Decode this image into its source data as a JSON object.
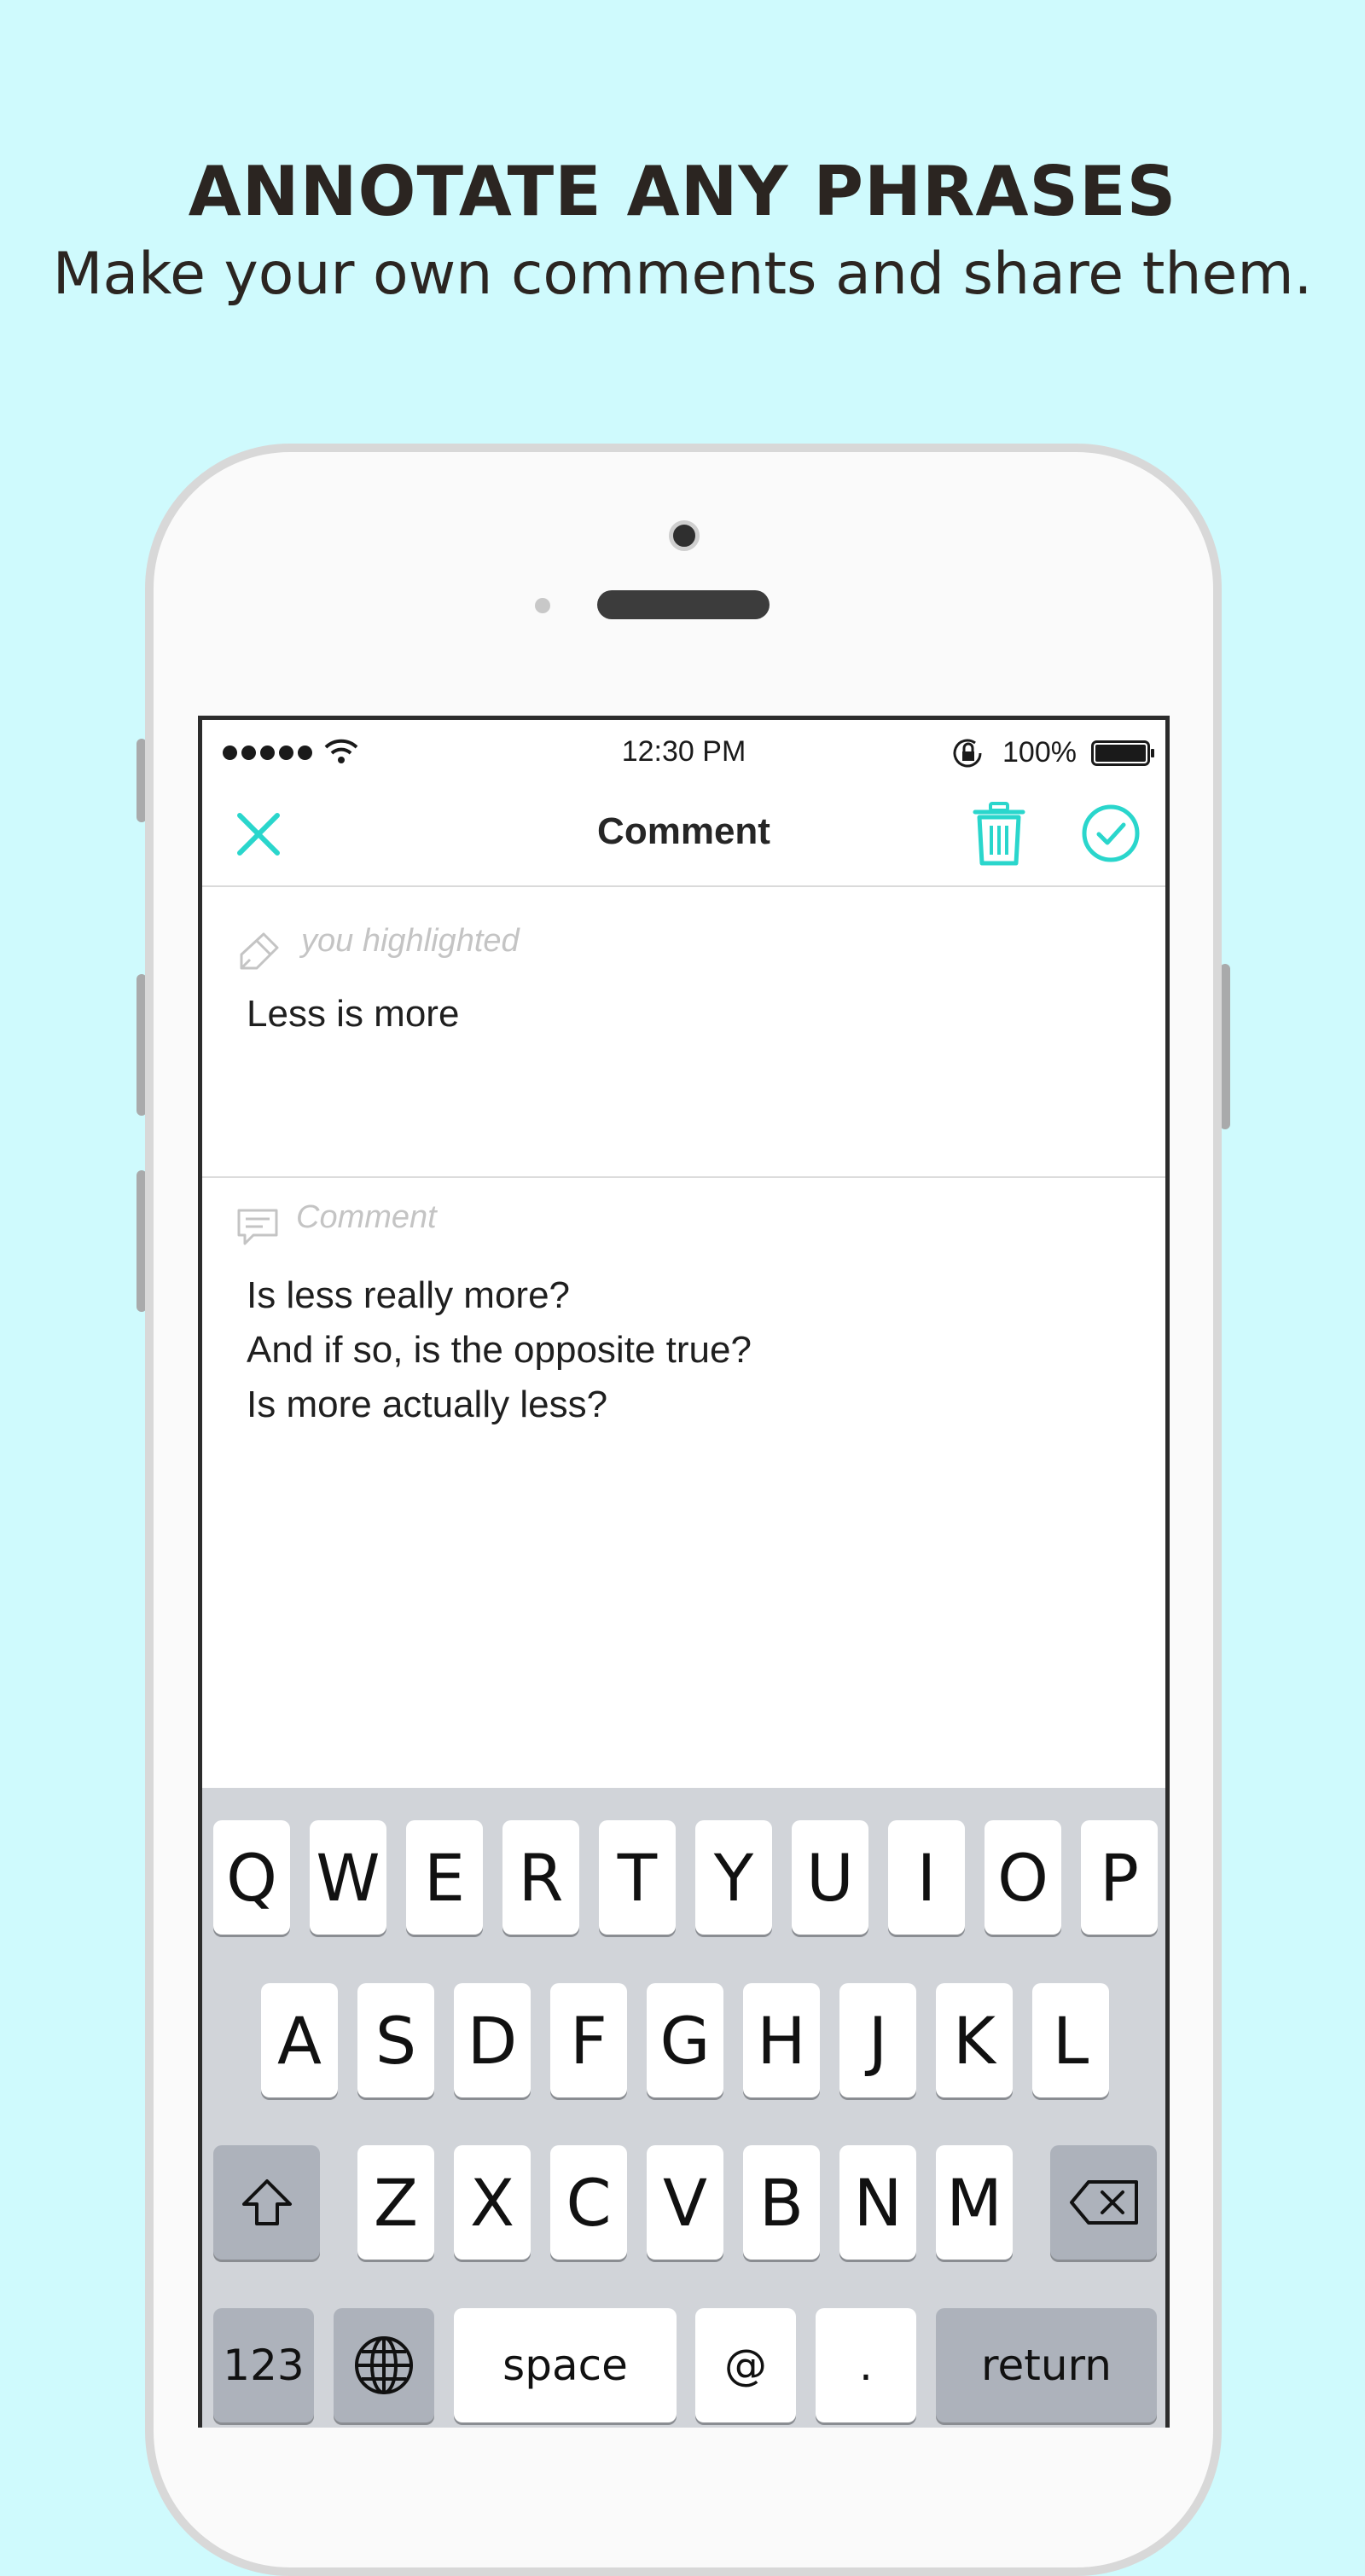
{
  "headline": "ANNOTATE ANY PHRASES",
  "subheadline": "Make your own comments and share them.",
  "status_bar": {
    "signal_icon": "signal-dots-icon",
    "wifi_icon": "wifi-icon",
    "time": "12:30 PM",
    "lock_icon": "orientation-lock-icon",
    "battery_percent": "100%",
    "battery_icon": "battery-icon"
  },
  "nav": {
    "title": "Comment",
    "close_icon": "close-icon",
    "delete_icon": "trash-icon",
    "confirm_icon": "check-circle-icon",
    "accent_color": "#2ad6cc"
  },
  "highlight": {
    "label": "you highlighted",
    "icon": "highlighter-pen-icon",
    "text": "Less is more"
  },
  "comment": {
    "label": "Comment",
    "icon": "comment-bubble-icon",
    "lines": [
      "Is less really more?",
      "And if so, is the opposite true?",
      "Is more actually less?"
    ]
  },
  "keyboard": {
    "row1": [
      "Q",
      "W",
      "E",
      "R",
      "T",
      "Y",
      "U",
      "I",
      "O",
      "P"
    ],
    "row2": [
      "A",
      "S",
      "D",
      "F",
      "G",
      "H",
      "J",
      "K",
      "L"
    ],
    "row3": [
      "Z",
      "X",
      "C",
      "V",
      "B",
      "N",
      "M"
    ],
    "shift_icon": "shift-arrow-icon",
    "delete_icon": "backspace-icon",
    "numbers_label": "123",
    "globe_icon": "globe-icon",
    "space_label": "space",
    "at_label": "@",
    "period_label": ".",
    "return_label": "return"
  }
}
